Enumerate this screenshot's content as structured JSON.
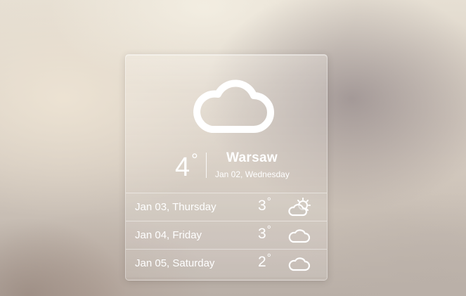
{
  "widget": {
    "current": {
      "icon": "cloud-icon",
      "temperature": "4",
      "degree_symbol": "°",
      "city": "Warsaw",
      "date": "Jan 02, Wednesday"
    },
    "forecast": [
      {
        "date": "Jan 03, Thursday",
        "temperature": "3",
        "degree_symbol": "°",
        "icon": "partly-sunny-icon"
      },
      {
        "date": "Jan 04, Friday",
        "temperature": "3",
        "degree_symbol": "°",
        "icon": "cloud-icon"
      },
      {
        "date": "Jan 05, Saturday",
        "temperature": "2",
        "degree_symbol": "°",
        "icon": "cloud-icon"
      }
    ]
  },
  "colors": {
    "text": "#ffffff",
    "icon_stroke": "#ffffff"
  }
}
